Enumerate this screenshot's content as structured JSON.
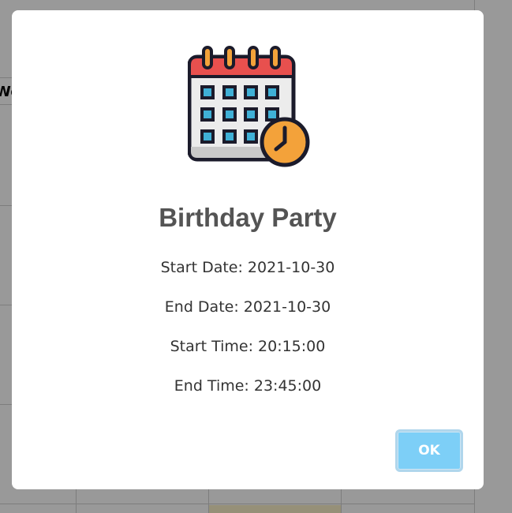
{
  "background": {
    "header_fragment": "We"
  },
  "modal": {
    "icon": "calendar-clock-icon",
    "title": "Birthday Party",
    "details": [
      "Start Date: 2021-10-30",
      "End Date: 2021-10-30",
      "Start Time: 20:15:00",
      "End Time: 23:45:00"
    ],
    "ok_label": "OK"
  },
  "colors": {
    "overlay": "#999999",
    "button": "#7dcff7",
    "title": "#545454"
  }
}
